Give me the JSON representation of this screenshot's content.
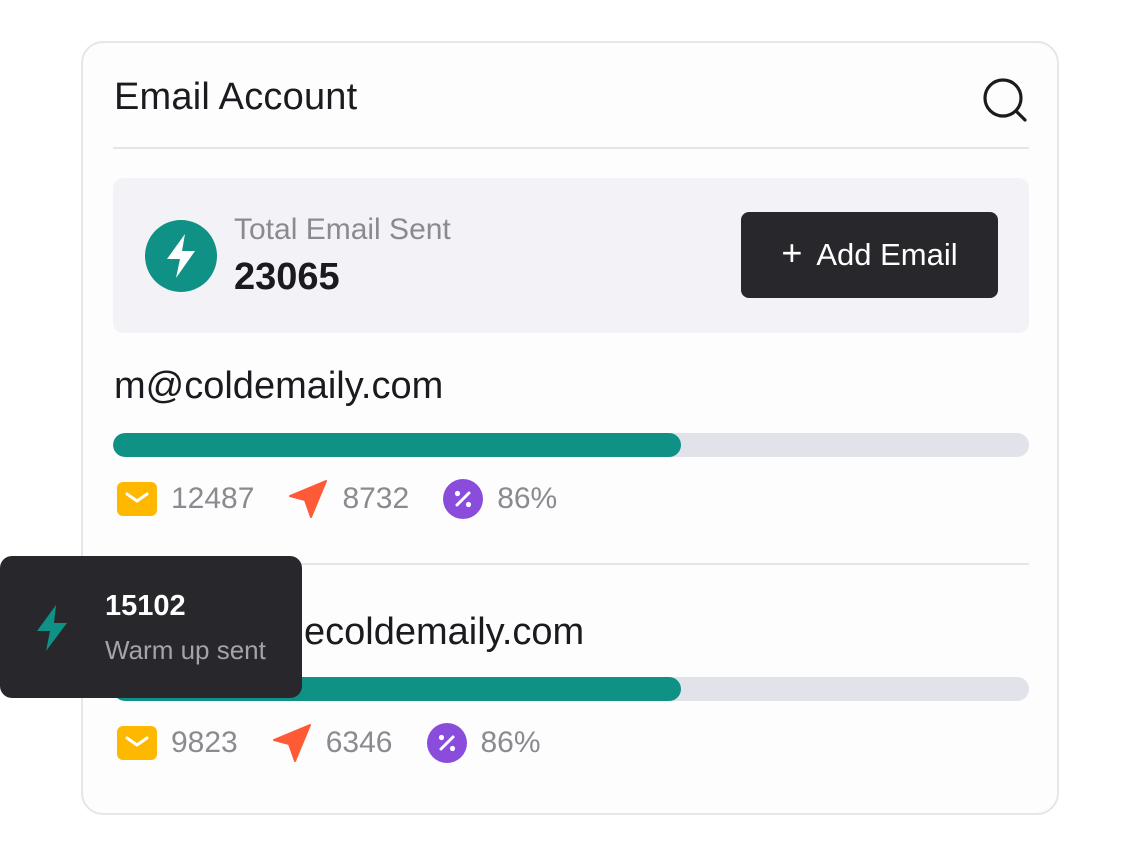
{
  "header": {
    "title": "Email Account",
    "search_icon": "search-icon"
  },
  "summary": {
    "icon": "lightning-icon",
    "label": "Total Email Sent",
    "value": "23065",
    "add_button": {
      "icon": "plus-icon",
      "label": "Add Email"
    }
  },
  "accounts": [
    {
      "email": "m@coldemaily.com",
      "progress_percent": 62,
      "stats": [
        {
          "icon": "mail-icon",
          "value": "12487"
        },
        {
          "icon": "send-icon",
          "value": "8732"
        },
        {
          "icon": "percent-icon",
          "value": "86%"
        }
      ]
    },
    {
      "email": "ecoldemaily.com",
      "progress_percent": 62,
      "stats": [
        {
          "icon": "mail-icon",
          "value": "9823"
        },
        {
          "icon": "send-icon",
          "value": "6346"
        },
        {
          "icon": "percent-icon",
          "value": "86%"
        }
      ]
    }
  ],
  "tooltip": {
    "icon": "lightning-icon",
    "value": "15102",
    "label": "Warm up sent"
  },
  "colors": {
    "accent": "#0f9186",
    "dark": "#28272b",
    "mail": "#ffb800",
    "send": "#ff5a36",
    "percent": "#8a4ddb",
    "track": "#e1e2ea"
  }
}
